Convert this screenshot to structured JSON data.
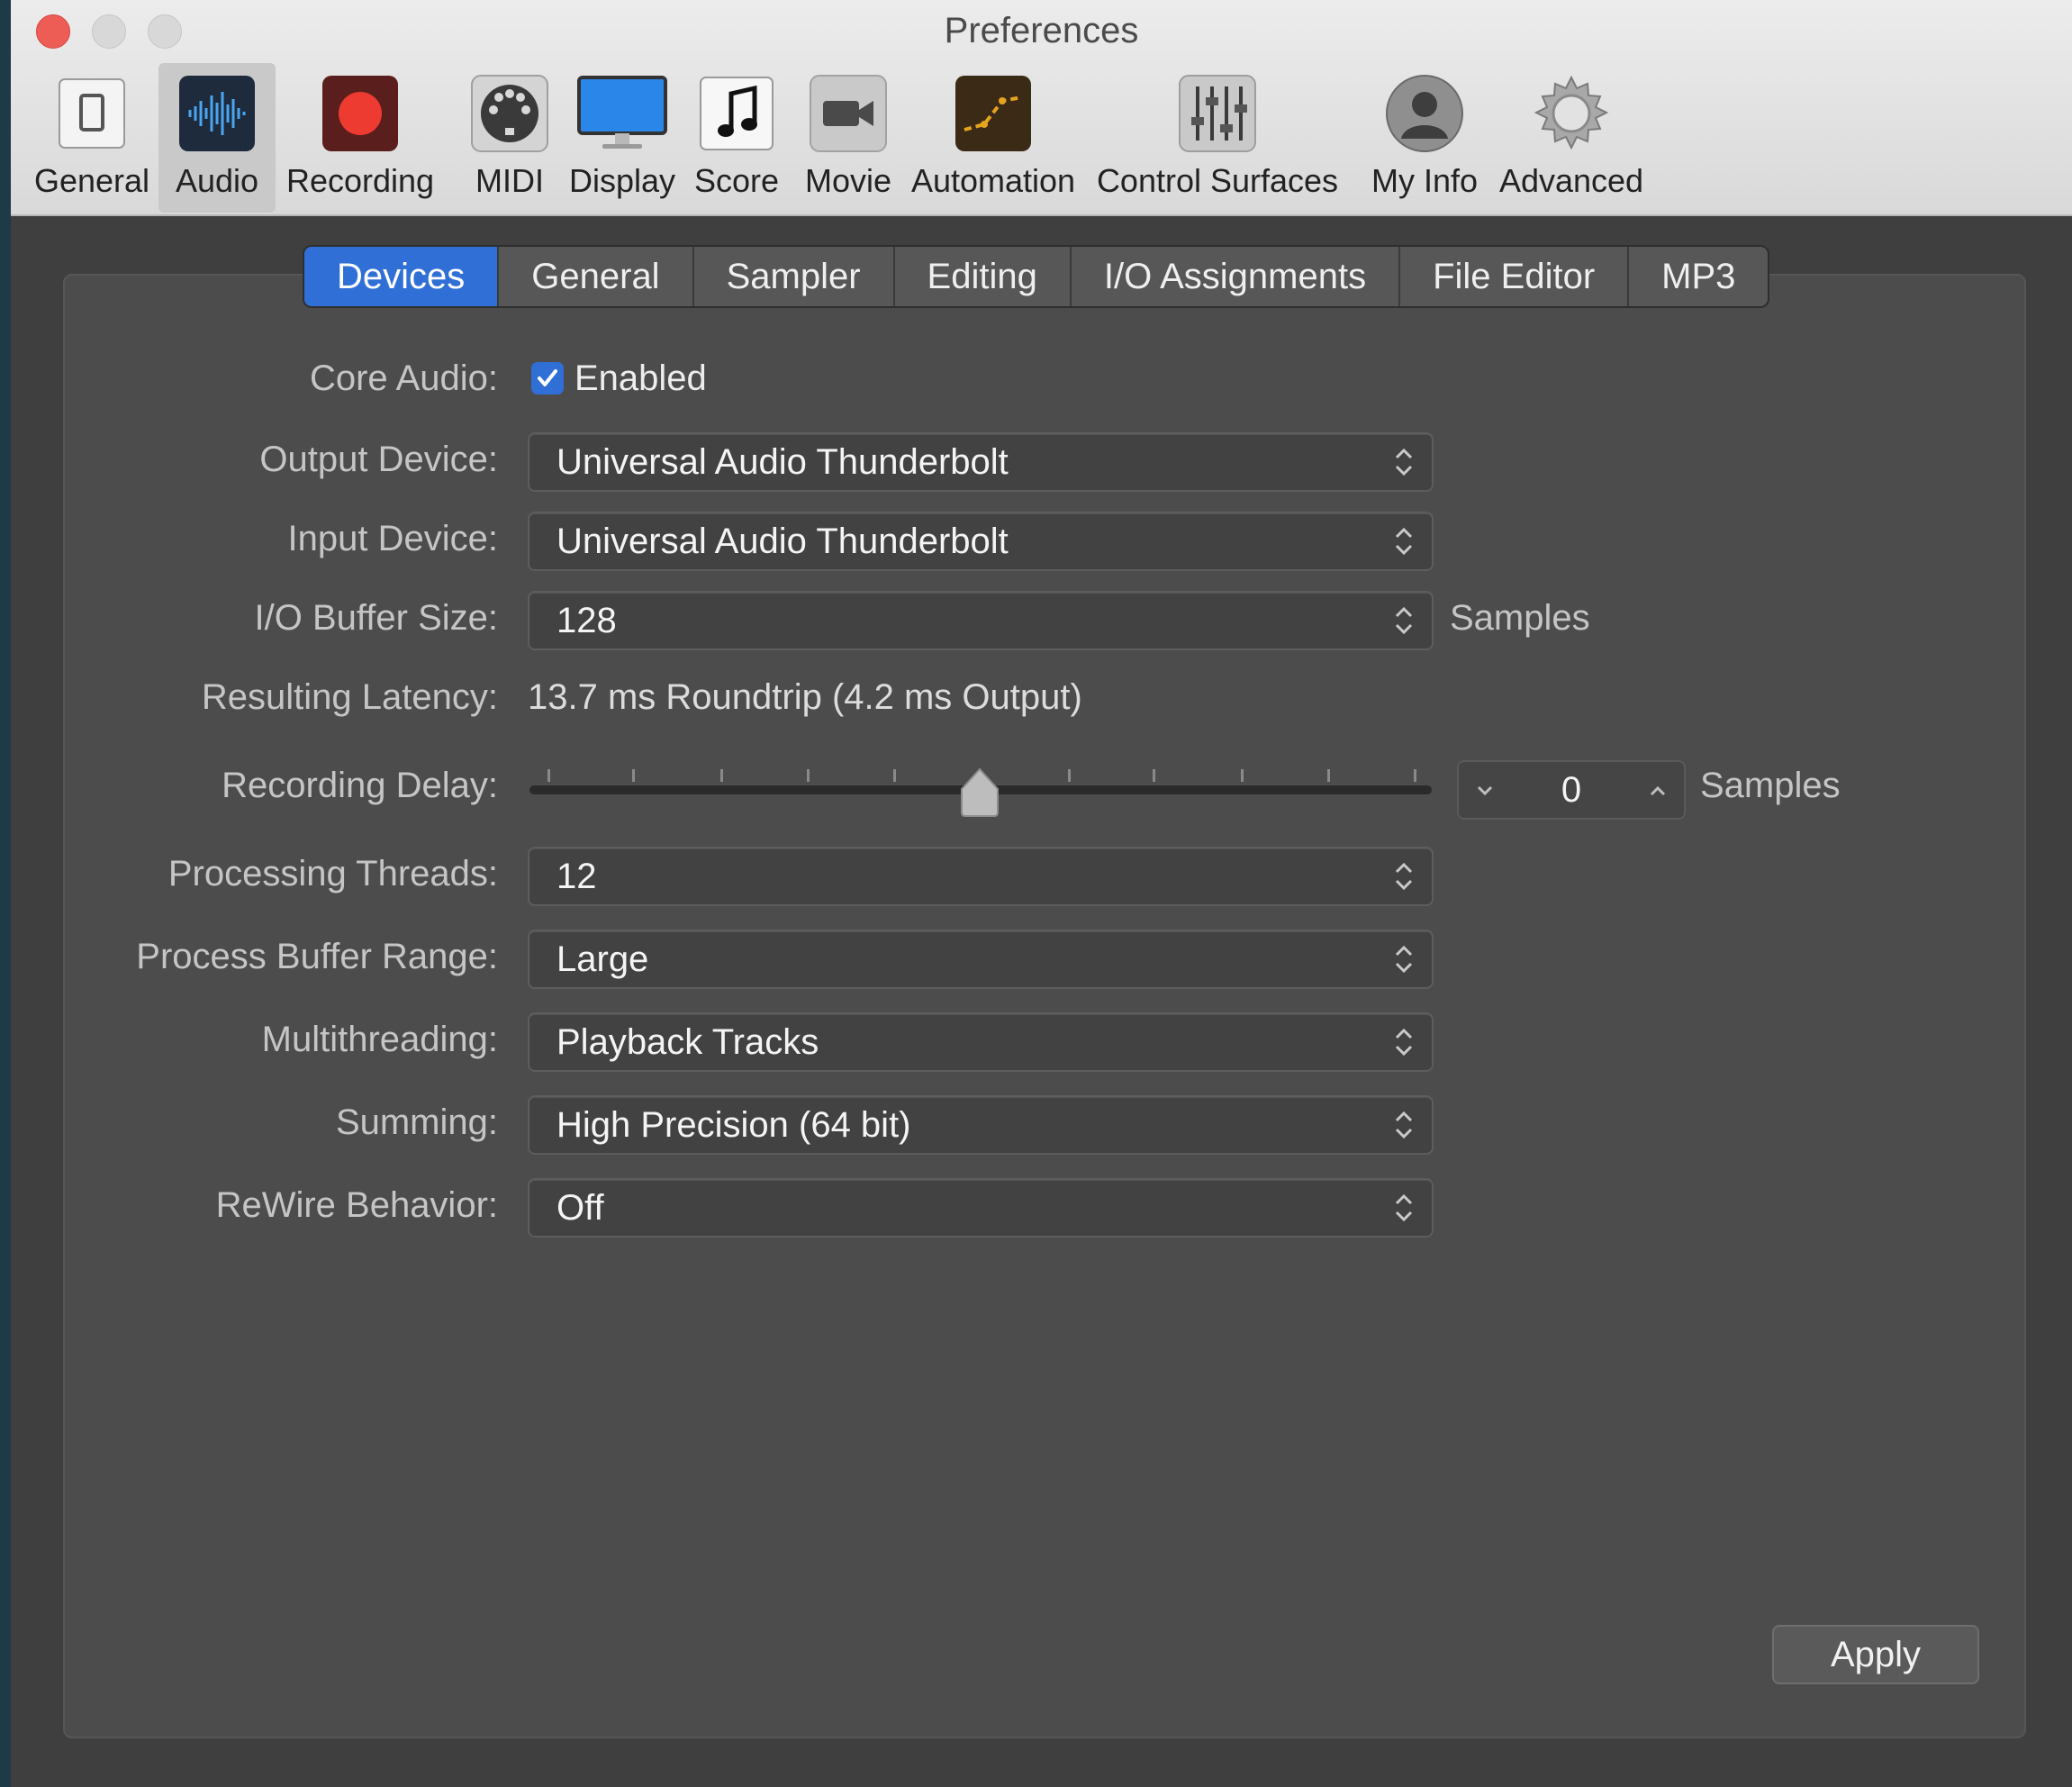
{
  "window": {
    "title": "Preferences"
  },
  "toolbar": {
    "items": [
      {
        "label": "General",
        "icon": "general-icon"
      },
      {
        "label": "Audio",
        "icon": "audio-waveform-icon",
        "selected": true
      },
      {
        "label": "Recording",
        "icon": "record-icon"
      },
      {
        "label": "MIDI",
        "icon": "midi-connector-icon"
      },
      {
        "label": "Display",
        "icon": "display-monitor-icon"
      },
      {
        "label": "Score",
        "icon": "music-note-icon"
      },
      {
        "label": "Movie",
        "icon": "video-camera-icon"
      },
      {
        "label": "Automation",
        "icon": "automation-curve-icon"
      },
      {
        "label": "Control Surfaces",
        "icon": "faders-icon"
      },
      {
        "label": "My Info",
        "icon": "user-silhouette-icon"
      },
      {
        "label": "Advanced",
        "icon": "gear-icon"
      }
    ]
  },
  "tabs": [
    {
      "label": "Devices",
      "active": true
    },
    {
      "label": "General"
    },
    {
      "label": "Sampler"
    },
    {
      "label": "Editing"
    },
    {
      "label": "I/O Assignments"
    },
    {
      "label": "File Editor"
    },
    {
      "label": "MP3"
    }
  ],
  "settings": {
    "core_audio": {
      "label": "Core Audio:",
      "checkbox_label": "Enabled",
      "checked": true
    },
    "output_device": {
      "label": "Output Device:",
      "value": "Universal Audio Thunderbolt"
    },
    "input_device": {
      "label": "Input Device:",
      "value": "Universal Audio Thunderbolt"
    },
    "io_buffer_size": {
      "label": "I/O Buffer Size:",
      "value": "128",
      "unit": "Samples"
    },
    "resulting_latency": {
      "label": "Resulting Latency:",
      "value": "13.7 ms Roundtrip (4.2 ms Output)"
    },
    "recording_delay": {
      "label": "Recording Delay:",
      "value": "0",
      "unit": "Samples",
      "slider_position": 0.5
    },
    "processing_threads": {
      "label": "Processing Threads:",
      "value": "12"
    },
    "process_buffer_range": {
      "label": "Process Buffer Range:",
      "value": "Large"
    },
    "multithreading": {
      "label": "Multithreading:",
      "value": "Playback Tracks"
    },
    "summing": {
      "label": "Summing:",
      "value": "High Precision (64 bit)"
    },
    "rewire_behavior": {
      "label": "ReWire Behavior:",
      "value": "Off"
    }
  },
  "buttons": {
    "apply": "Apply"
  },
  "colors": {
    "accent": "#2f6fd6",
    "record": "#ee3b32",
    "close": "#ed5c55"
  }
}
